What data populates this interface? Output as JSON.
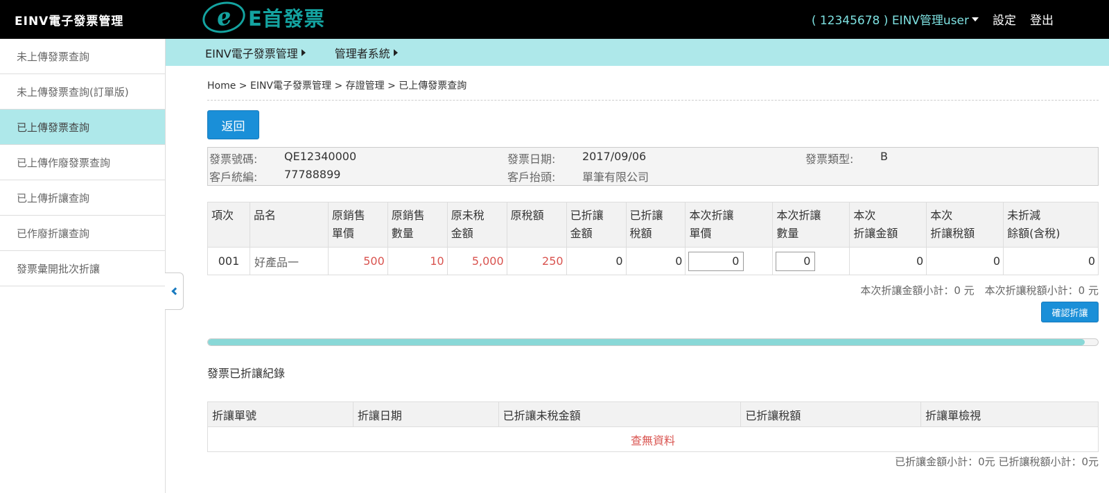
{
  "header": {
    "app_title": "EINV電子發票管理",
    "logo_letter": "e",
    "logo_text": "E首發票",
    "user_label": "( 12345678 ) EINV管理user",
    "settings_label": "設定",
    "logout_label": "登出"
  },
  "sidebar": {
    "items": [
      {
        "label": "未上傳發票查詢"
      },
      {
        "label": "未上傳發票查詢(訂單版)"
      },
      {
        "label": "已上傳發票查詢",
        "active": true
      },
      {
        "label": "已上傳作廢發票查詢"
      },
      {
        "label": "已上傳折讓查詢"
      },
      {
        "label": "已作廢折讓查詢"
      },
      {
        "label": "發票彙開批次折讓"
      }
    ]
  },
  "menubar": {
    "items": [
      {
        "label": "EINV電子發票管理"
      },
      {
        "label": "管理者系統"
      }
    ]
  },
  "breadcrumb": "Home > EINV電子發票管理 > 存證管理 > 已上傳發票查詢",
  "back_button": "返回",
  "invoice_info": {
    "number_label": "發票號碼:",
    "number_value": "QE12340000",
    "date_label": "發票日期:",
    "date_value": "2017/09/06",
    "type_label": "發票類型:",
    "type_value": "B",
    "customer_id_label": "客戶統編:",
    "customer_id_value": "77788899",
    "customer_name_label": "客戶抬頭:",
    "customer_name_value": "單筆有限公司"
  },
  "items_table": {
    "headers": [
      [
        "項次"
      ],
      [
        "品名"
      ],
      [
        "原銷售",
        "單價"
      ],
      [
        "原銷售",
        "數量"
      ],
      [
        "原未稅",
        "金額"
      ],
      [
        "原稅額"
      ],
      [
        "已折讓",
        "金額"
      ],
      [
        "已折讓",
        "稅額"
      ],
      [
        "本次折讓",
        "單價"
      ],
      [
        "本次折讓",
        "數量"
      ],
      [
        "本次",
        "折讓金額"
      ],
      [
        "本次",
        "折讓稅額"
      ],
      [
        "未折減",
        "餘額(含稅)"
      ]
    ],
    "rows": [
      {
        "no": "001",
        "name": "好產品一",
        "unit_price": "500",
        "qty": "10",
        "amount": "5,000",
        "tax": "250",
        "allowed_amount": "0",
        "allowed_tax": "0",
        "cur_unit_price": "0",
        "cur_qty": "0",
        "cur_amount": "0",
        "cur_tax": "0",
        "remain": "0"
      }
    ]
  },
  "subtotal_text": "本次折讓金額小計：0 元　本次折讓稅額小計：0 元",
  "confirm_button": "確認折讓",
  "progress": {
    "fraction": 0.985
  },
  "records": {
    "title": "發票已折讓紀錄",
    "headers": [
      "折讓單號",
      "折讓日期",
      "已折讓未稅金額",
      "已折讓稅額",
      "折讓單檢視"
    ],
    "empty_text": "查無資料",
    "total_text": "已折讓金額小計：0元 已折讓稅額小計：0元"
  },
  "colors": {
    "accent": "#aee8ea",
    "button": "#1a8fd8",
    "logo": "#14a3a0",
    "red": "#d9534f"
  }
}
